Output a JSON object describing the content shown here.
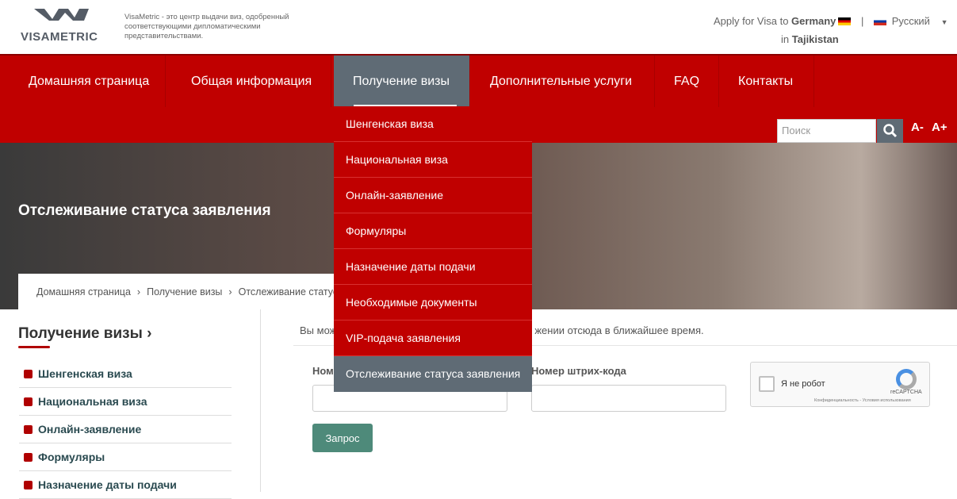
{
  "header": {
    "logo_text": "VISAMETRIC",
    "tagline": "VisaMetric - это центр выдачи виз, одобренный соответствующими дипломатическими представительствами.",
    "apply_prefix": "Apply for Visa to",
    "country": "Germany",
    "separator": "|",
    "language": "Русский",
    "in_prefix": "in",
    "location": "Tajikistan"
  },
  "nav": {
    "items": [
      {
        "label": "Домашняя страница"
      },
      {
        "label": "Общая информация"
      },
      {
        "label": "Получение визы",
        "active": true
      },
      {
        "label": "Дополнительные услуги"
      },
      {
        "label": "FAQ"
      },
      {
        "label": "Контакты"
      }
    ],
    "search_placeholder": "Поиск",
    "font_decrease": "A-",
    "font_increase": "A+"
  },
  "dropdown": {
    "items": [
      {
        "label": "Шенгенская виза"
      },
      {
        "label": "Национальная виза"
      },
      {
        "label": "Онлайн-заявление"
      },
      {
        "label": "Формуляры"
      },
      {
        "label": "Назначение даты подачи"
      },
      {
        "label": "Необходимые документы"
      },
      {
        "label": "VIP-подача заявления"
      },
      {
        "label": "Отслеживание статуса заявления",
        "active": true
      }
    ]
  },
  "hero": {
    "title": "Отслеживание статуса заявления"
  },
  "breadcrumb": [
    "Домашняя страница",
    "Получение визы",
    "Отслеживание статуса заявления"
  ],
  "sidebar": {
    "title": "Получение визы ›",
    "items": [
      {
        "label": "Шенгенская виза"
      },
      {
        "label": "Национальная виза"
      },
      {
        "label": "Онлайн-заявление"
      },
      {
        "label": "Формуляры"
      },
      {
        "label": "Назначение даты подачи"
      }
    ]
  },
  "main": {
    "info_start": "Вы мож",
    "info_end": "жении отсюда в ближайшее время.",
    "field1_label": "Ном",
    "field2_label": "Номер штрих-кода",
    "field1_value": "",
    "field2_value": "",
    "submit_label": "Запрос"
  },
  "captcha": {
    "label": "Я не робот",
    "brand": "reCAPTCHA",
    "links": "Конфиденциальность - Условия использования"
  },
  "colors": {
    "brand_red": "#c00000",
    "active_gray": "#5f6b75",
    "button_green": "#4e8a7a"
  }
}
